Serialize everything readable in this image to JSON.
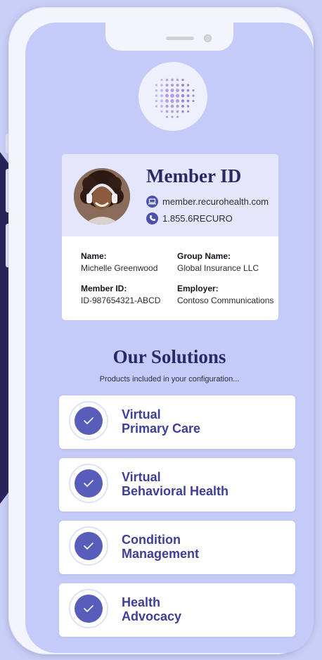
{
  "colors": {
    "background": "#c9cff7",
    "screen": "#c5cbf8",
    "brand_navy": "#2a2868",
    "accent_purple": "#575db8",
    "label_purple": "#3e3f98"
  },
  "logo": {
    "icon": "dotted-globe-logo-icon"
  },
  "member_card": {
    "title": "Member ID",
    "avatar_icon": "member-photo",
    "website": "member.recurohealth.com",
    "website_icon": "laptop-icon",
    "phone": "1.855.6RECURO",
    "phone_icon": "phone-icon",
    "fields": {
      "name_label": "Name:",
      "name_value": "Michelle Greenwood",
      "group_label": "Group Name:",
      "group_value": "Global Insurance LLC",
      "member_id_label": "Member ID:",
      "member_id_value": "ID-987654321-ABCD",
      "employer_label": "Employer:",
      "employer_value": "Contoso Communications"
    }
  },
  "solutions": {
    "title": "Our Solutions",
    "subtitle": "Products included in your configuration...",
    "check_icon": "checkmark-icon",
    "items": [
      {
        "line1": "Virtual",
        "line2": "Primary Care"
      },
      {
        "line1": "Virtual",
        "line2": "Behavioral Health"
      },
      {
        "line1": "Condition",
        "line2": "Management"
      },
      {
        "line1": "Health",
        "line2": "Advocacy"
      }
    ]
  }
}
